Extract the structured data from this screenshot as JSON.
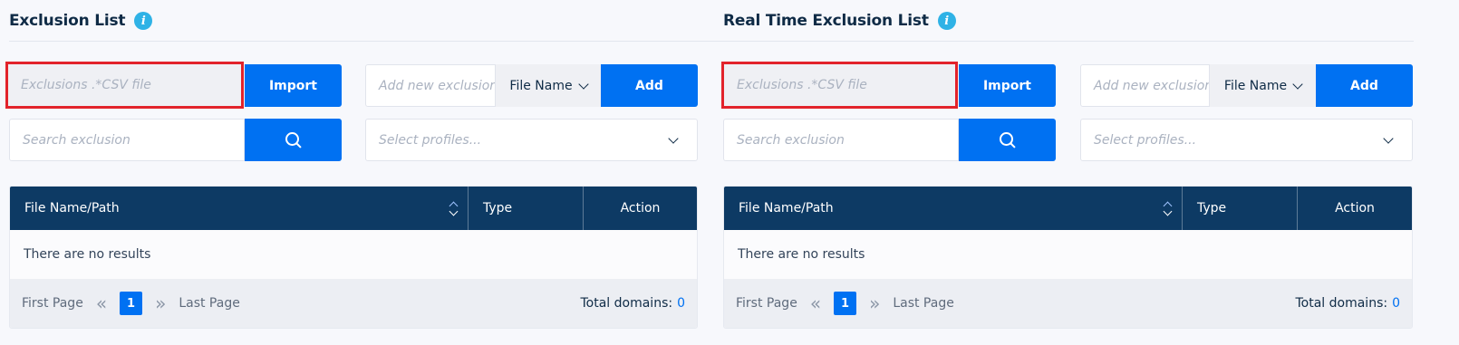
{
  "panels": [
    {
      "title": "Exclusion List",
      "info_icon": "info-icon",
      "file_input": {
        "placeholder": "Exclusions .*CSV file"
      },
      "import_label": "Import",
      "new_exclusion": {
        "placeholder": "Add new exclusion"
      },
      "type_select": "File Name",
      "add_label": "Add",
      "search": {
        "placeholder": "Search exclusion"
      },
      "profiles": {
        "placeholder": "Select profiles..."
      },
      "table": {
        "columns": [
          "File Name/Path",
          "Type",
          "Action"
        ],
        "empty_text": "There are no results"
      },
      "pager": {
        "first": "First Page",
        "last": "Last Page",
        "current_page": "1",
        "total_label": "Total domains:",
        "total_value": "0"
      }
    },
    {
      "title": "Real Time Exclusion List",
      "info_icon": "info-icon",
      "file_input": {
        "placeholder": "Exclusions .*CSV file"
      },
      "import_label": "Import",
      "new_exclusion": {
        "placeholder": "Add new exclusion"
      },
      "type_select": "File Name",
      "add_label": "Add",
      "search": {
        "placeholder": "Search exclusion"
      },
      "profiles": {
        "placeholder": "Select profiles..."
      },
      "table": {
        "columns": [
          "File Name/Path",
          "Type",
          "Action"
        ],
        "empty_text": "There are no results"
      },
      "pager": {
        "first": "First Page",
        "last": "Last Page",
        "current_page": "1",
        "total_label": "Total domains:",
        "total_value": "0"
      }
    }
  ],
  "colors": {
    "accent": "#0071f2",
    "header": "#0d3a64",
    "highlight": "#e2232b",
    "info": "#2fb2e6"
  }
}
